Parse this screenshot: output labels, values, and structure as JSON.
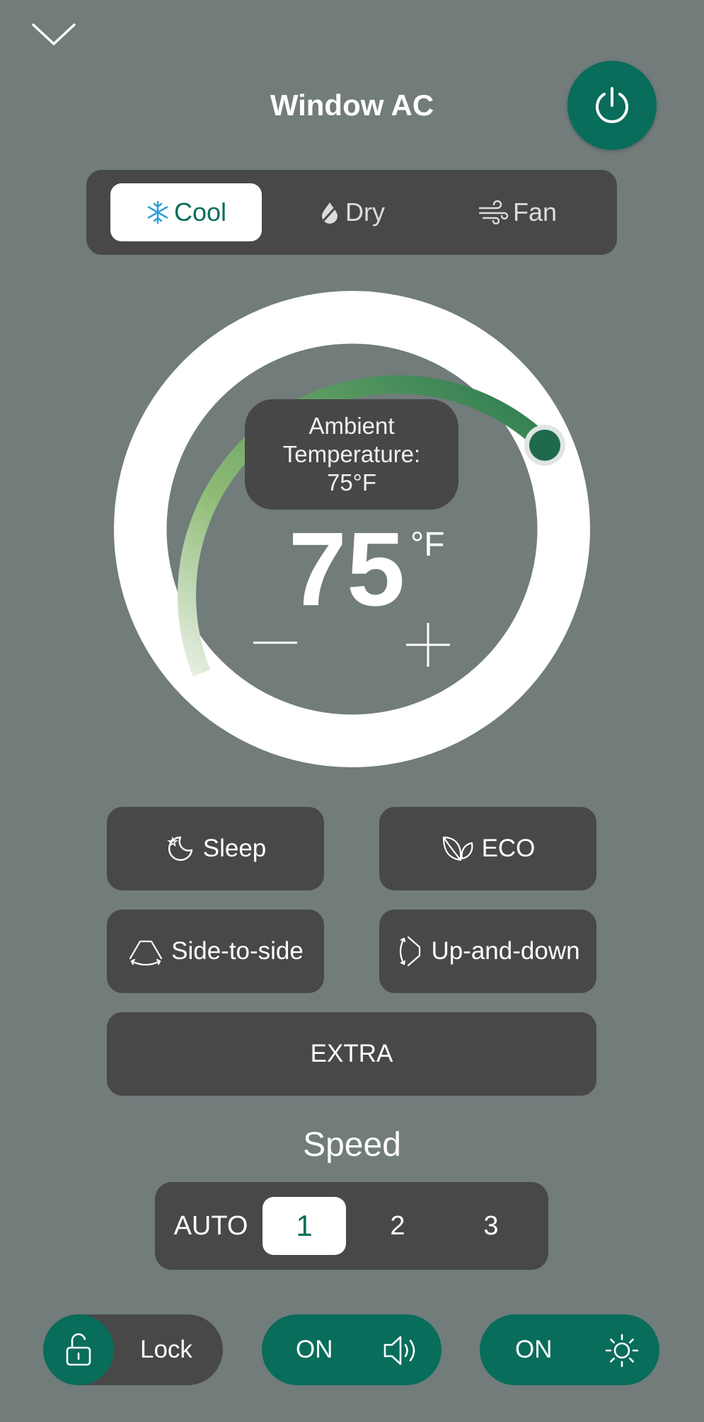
{
  "header": {
    "title": "Window AC"
  },
  "modes": [
    {
      "label": "Cool",
      "icon": "snowflake-icon",
      "active": true
    },
    {
      "label": "Dry",
      "icon": "drop-icon",
      "active": false
    },
    {
      "label": "Fan",
      "icon": "wind-icon",
      "active": false
    }
  ],
  "thermostat": {
    "ambient_label": "Ambient Temperature:",
    "ambient_value": "75°F",
    "setpoint": "75",
    "unit": "°F"
  },
  "features": {
    "sleep": "Sleep",
    "eco": "ECO",
    "side_to_side": "Side-to-side",
    "up_and_down": "Up-and-down",
    "extra": "EXTRA"
  },
  "speed": {
    "label": "Speed",
    "options": [
      "AUTO",
      "1",
      "2",
      "3"
    ],
    "selected": "1"
  },
  "toggles": {
    "lock_label": "Lock",
    "sound_state": "ON",
    "light_state": "ON"
  },
  "colors": {
    "background": "#717c7b",
    "accent": "#086d5a",
    "panel": "#484848"
  }
}
